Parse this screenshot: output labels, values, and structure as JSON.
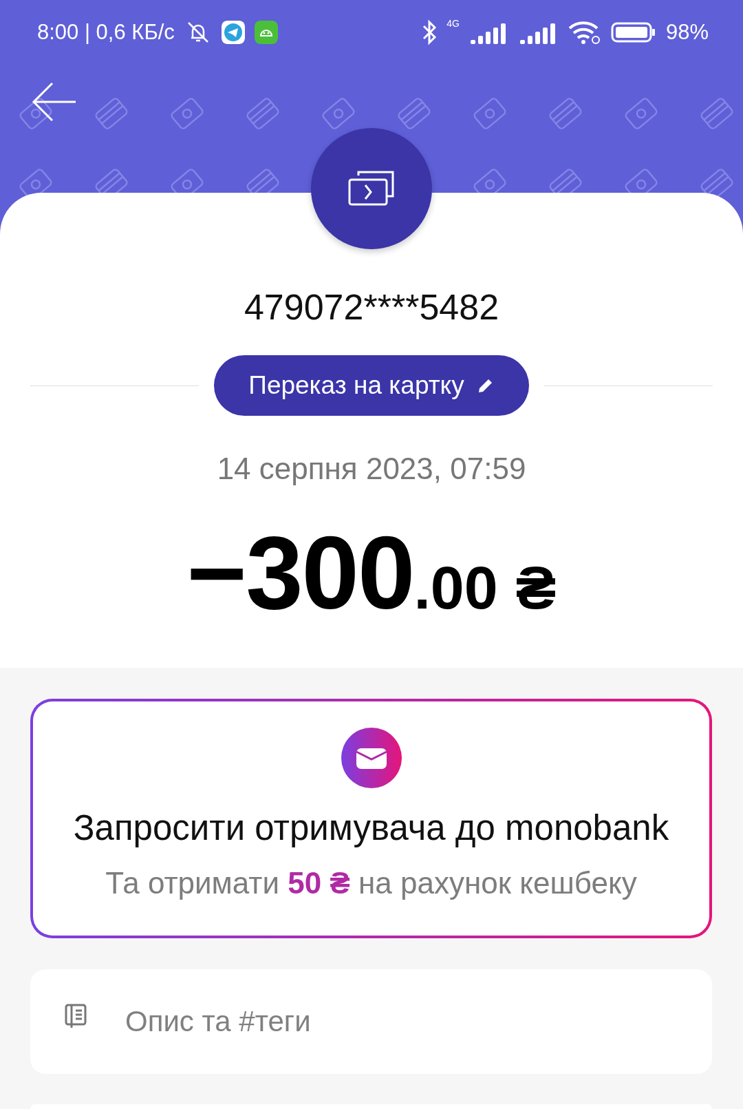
{
  "status_bar": {
    "time_speed": "8:00 | 0,6 КБ/с",
    "network": "4G",
    "battery": "98%"
  },
  "transfer": {
    "card_number": "479072****5482",
    "category": "Переказ на картку",
    "date": "14 серпня 2023, 07:59",
    "amount_integer": "−300",
    "amount_fraction": ".00",
    "currency": "₴"
  },
  "promo": {
    "title": "Запросити отримувача до monobank",
    "subtitle": "Та отримати **50 ₴** на рахунок кешбеку"
  },
  "description": {
    "placeholder": "Опис та #теги"
  }
}
